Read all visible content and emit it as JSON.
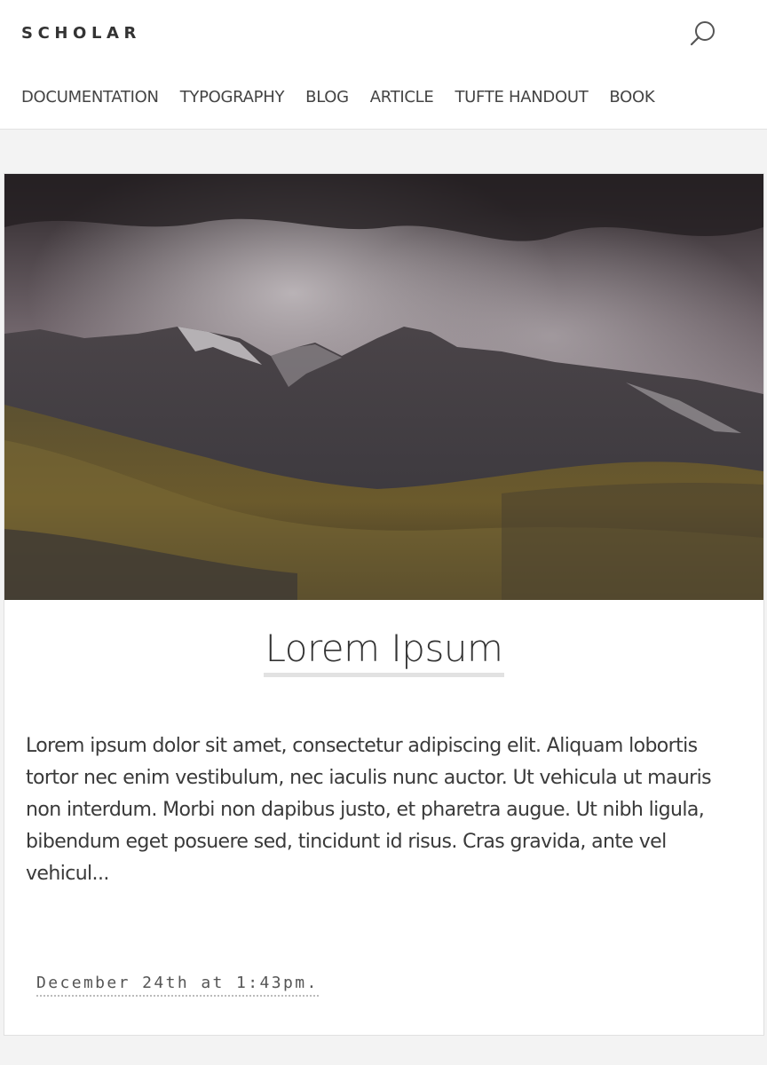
{
  "brand": "SCHOLAR",
  "header": {
    "search_icon": "search-icon"
  },
  "nav": {
    "items": [
      {
        "label": "DOCUMENTATION"
      },
      {
        "label": "TYPOGRAPHY"
      },
      {
        "label": "BLOG"
      },
      {
        "label": "ARTICLE"
      },
      {
        "label": "TUFTE HANDOUT"
      },
      {
        "label": "BOOK"
      }
    ]
  },
  "post": {
    "title": "Lorem Ipsum",
    "excerpt": "Lorem ipsum dolor sit amet, consectetur adipiscing elit. Aliquam lobortis tortor nec enim vestibulum, nec iaculis nunc auctor. Ut vehicula ut mauris non interdum. Morbi non dapibus justo, et pharetra augue. Ut nibh ligula, bibendum eget posuere sed, tincidunt id risus. Cras gravida, ante vel vehicul...",
    "date": "December 24th at 1:43pm."
  },
  "colors": {
    "page_bg": "#f3f3f3",
    "card_bg": "#ffffff",
    "text": "#333333",
    "title_underline": "#e2e2e2"
  }
}
